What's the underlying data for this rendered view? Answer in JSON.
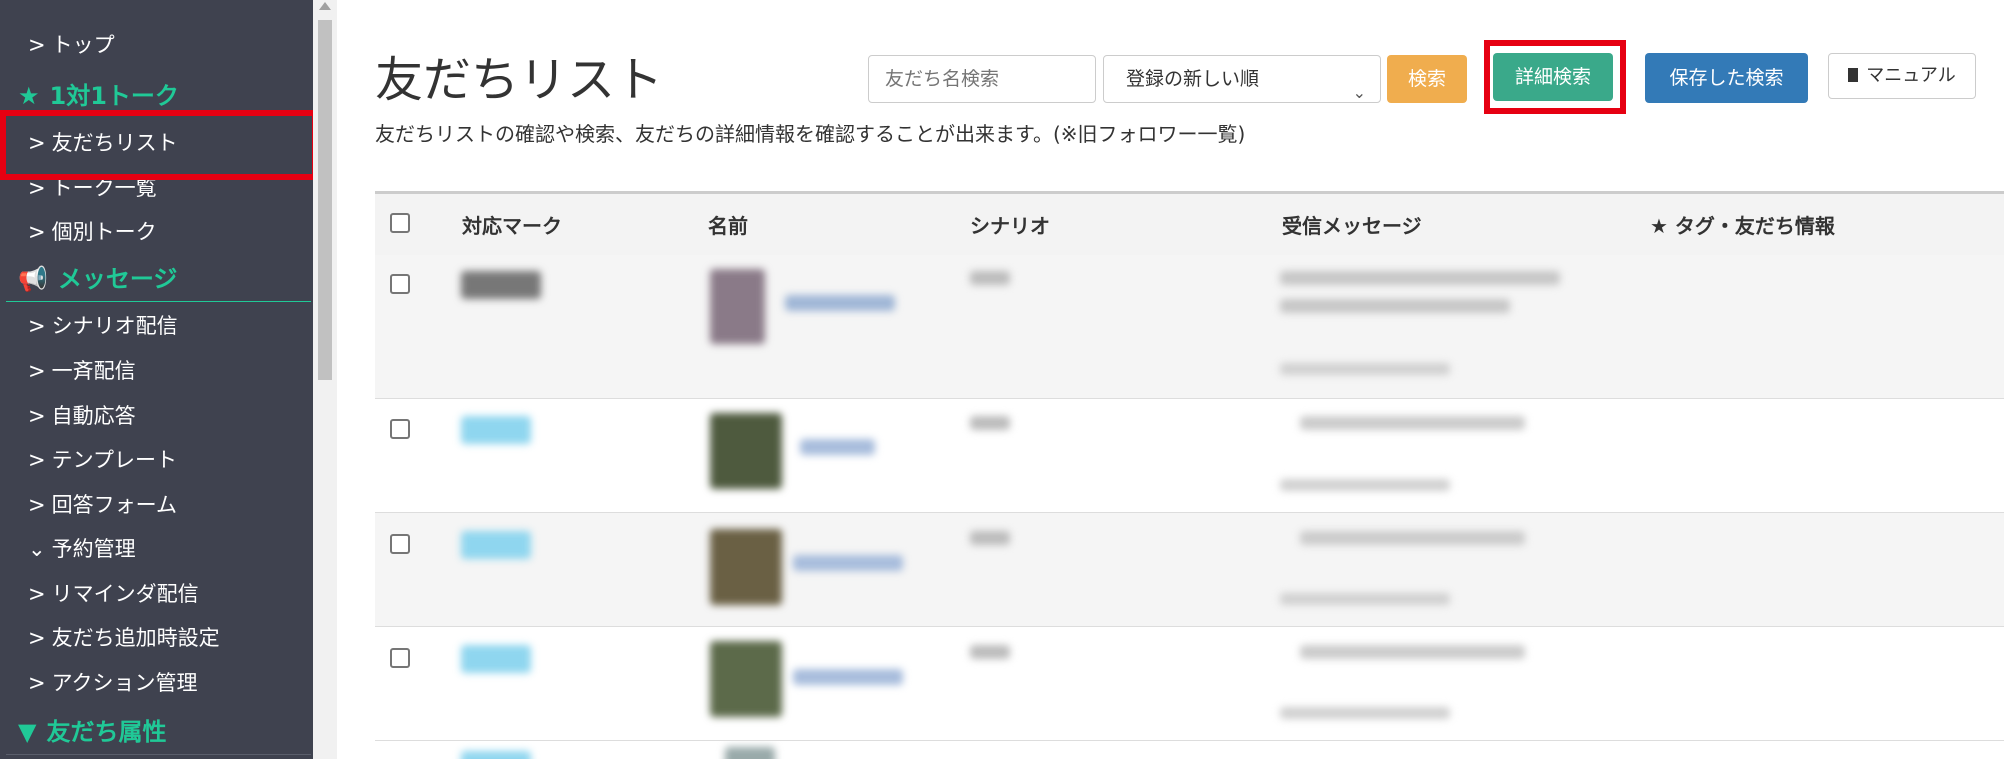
{
  "sidebar": {
    "items": [
      {
        "label": "トップ",
        "kind": "item"
      },
      {
        "label": "1対1トーク",
        "kind": "header",
        "icon": "star-icon"
      },
      {
        "label": "友だちリスト",
        "kind": "item",
        "highlighted": true
      },
      {
        "label": "トーク一覧",
        "kind": "item"
      },
      {
        "label": "個別トーク",
        "kind": "item"
      },
      {
        "label": "メッセージ",
        "kind": "header",
        "icon": "megaphone-icon"
      },
      {
        "label": "シナリオ配信",
        "kind": "item"
      },
      {
        "label": "一斉配信",
        "kind": "item"
      },
      {
        "label": "自動応答",
        "kind": "item"
      },
      {
        "label": "テンプレート",
        "kind": "item"
      },
      {
        "label": "回答フォーム",
        "kind": "item"
      },
      {
        "label": "予約管理",
        "kind": "item",
        "expanded": true
      },
      {
        "label": "リマインダ配信",
        "kind": "item"
      },
      {
        "label": "友だち追加時設定",
        "kind": "item"
      },
      {
        "label": "アクション管理",
        "kind": "item"
      },
      {
        "label": "友だち属性",
        "kind": "header",
        "icon": "filter-icon"
      }
    ],
    "colors": {
      "background": "#3f424f",
      "accent": "#20c997",
      "highlight": "#e60012"
    }
  },
  "main": {
    "title": "友だちリスト",
    "description": "友だちリストの確認や検索、友だちの詳細情報を確認することが出来ます。(※旧フォロワー一覧)",
    "search": {
      "placeholder": "友だち名検索",
      "sort_value": "登録の新しい順"
    },
    "buttons": {
      "search": "検索",
      "detail_search": "詳細検索",
      "saved_search": "保存した検索",
      "manual": "マニュアル"
    },
    "table": {
      "headers": [
        "対応マーク",
        "名前",
        "シナリオ",
        "受信メッセージ",
        "★ タグ・友だち情報"
      ],
      "rows_note": "blurred",
      "row_count_visible": 4
    }
  }
}
